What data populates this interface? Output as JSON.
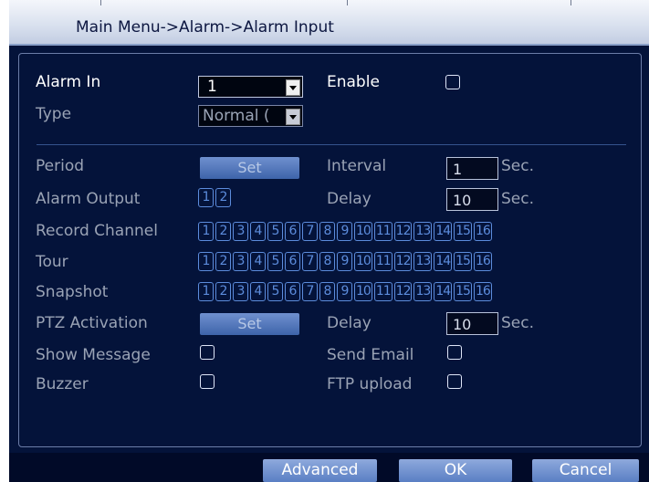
{
  "title": "Main Menu->Alarm->Alarm Input",
  "form": {
    "alarm_in": {
      "label": "Alarm In",
      "value": "1"
    },
    "enable": {
      "label": "Enable",
      "checked": false
    },
    "type": {
      "label": "Type",
      "value": "Normal ("
    },
    "period": {
      "label": "Period",
      "button": "Set"
    },
    "interval": {
      "label": "Interval",
      "value": "1",
      "unit": "Sec."
    },
    "alarm_output": {
      "label": "Alarm Output",
      "channels": [
        "1",
        "2"
      ]
    },
    "delay_top": {
      "label": "Delay",
      "value": "10",
      "unit": "Sec."
    },
    "record_channel": {
      "label": "Record Channel"
    },
    "tour": {
      "label": "Tour"
    },
    "snapshot": {
      "label": "Snapshot"
    },
    "channels": [
      "1",
      "2",
      "3",
      "4",
      "5",
      "6",
      "7",
      "8",
      "9",
      "10",
      "11",
      "12",
      "13",
      "14",
      "15",
      "16"
    ],
    "ptz_activation": {
      "label": "PTZ Activation",
      "button": "Set"
    },
    "delay_bottom": {
      "label": "Delay",
      "value": "10",
      "unit": "Sec."
    },
    "show_message": {
      "label": "Show Message",
      "checked": false
    },
    "send_email": {
      "label": "Send Email",
      "checked": false
    },
    "buzzer": {
      "label": "Buzzer",
      "checked": false
    },
    "ftp_upload": {
      "label": "FTP upload",
      "checked": false
    }
  },
  "footer": {
    "advanced": "Advanced",
    "ok": "OK",
    "cancel": "Cancel"
  },
  "colors": {
    "background": "#04133a",
    "accent": "#5c8cdc",
    "button": "#5a7fc4"
  }
}
